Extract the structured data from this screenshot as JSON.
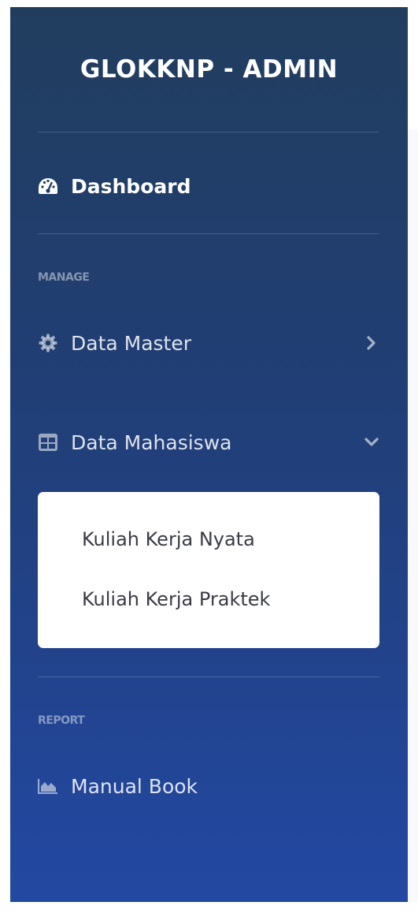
{
  "sidebar": {
    "brand": "GLOKKNP - ADMIN",
    "dashboard": {
      "label": "Dashboard",
      "icon": "tachometer-icon"
    },
    "sections": [
      {
        "heading": "MANAGE",
        "items": [
          {
            "label": "Data Master",
            "icon": "gear-icon",
            "arrow": "chevron-right-icon",
            "expanded": false
          },
          {
            "label": "Data Mahasiswa",
            "icon": "table-icon",
            "arrow": "chevron-down-icon",
            "expanded": true,
            "submenu": [
              "Kuliah Kerja Nyata",
              "Kuliah Kerja Praktek"
            ]
          }
        ]
      },
      {
        "heading": "REPORT",
        "items": [
          {
            "label": "Manual Book",
            "icon": "area-chart-icon"
          }
        ]
      }
    ]
  },
  "colors": {
    "sidebar_top": "#213d5e",
    "sidebar_bottom": "#2248a2",
    "submenu_bg": "#ffffff",
    "submenu_text": "#3a3b45"
  }
}
